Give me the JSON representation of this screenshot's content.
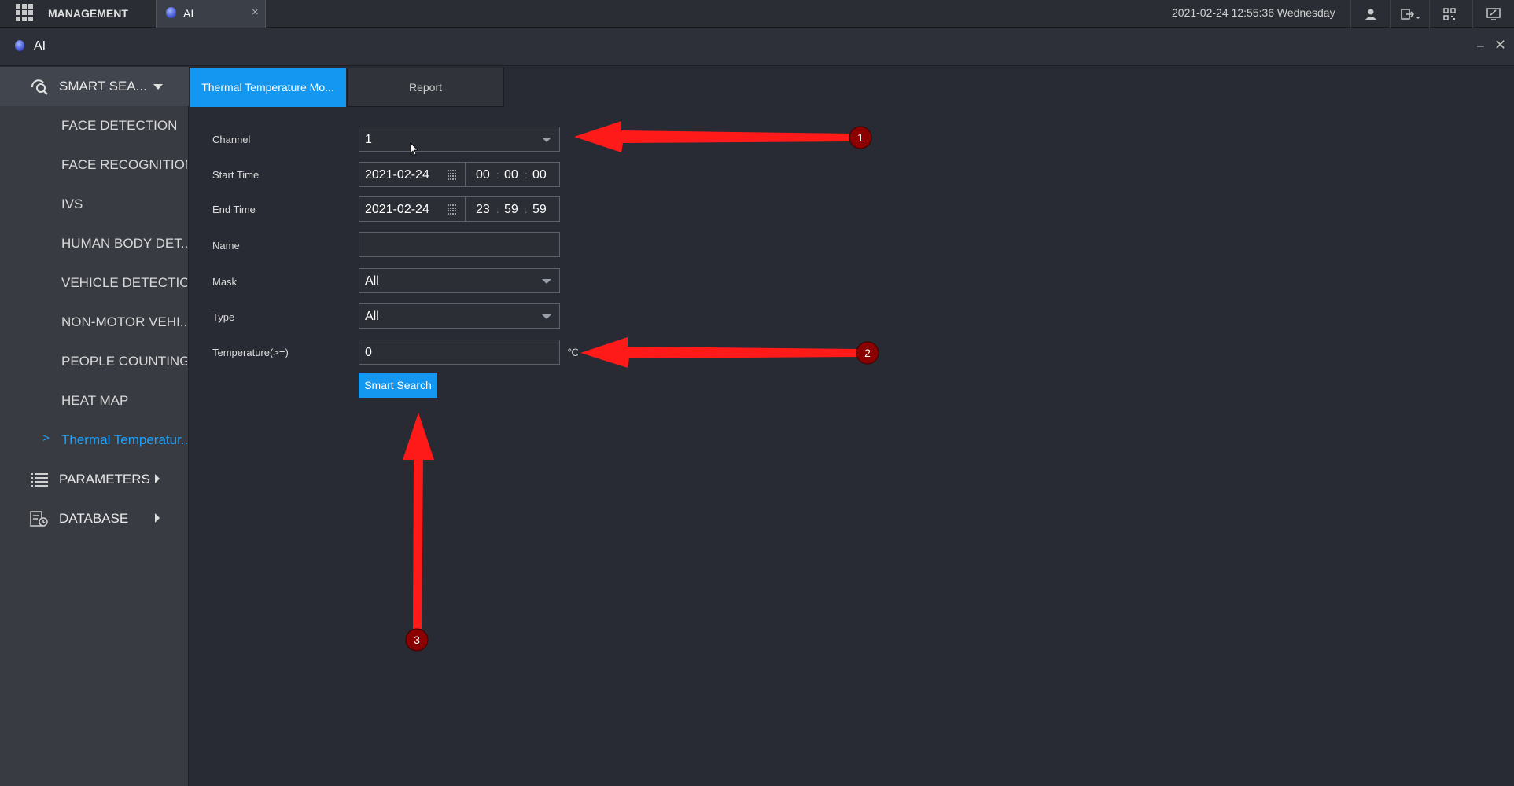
{
  "topbar": {
    "app_label": "MANAGEMENT",
    "tab_label": "AI",
    "tab_close": "×",
    "datetime": "2021-02-24 12:55:36 Wednesday"
  },
  "window": {
    "title": "AI",
    "minimize": "–",
    "close": "✕"
  },
  "sidebar": {
    "smart_search": "SMART SEA...",
    "items": [
      {
        "label": "FACE DETECTION"
      },
      {
        "label": "FACE RECOGNITION"
      },
      {
        "label": "IVS"
      },
      {
        "label": "HUMAN BODY DET..."
      },
      {
        "label": "VEHICLE DETECTION"
      },
      {
        "label": "NON-MOTOR VEHI..."
      },
      {
        "label": "PEOPLE COUNTING"
      },
      {
        "label": "HEAT MAP"
      },
      {
        "label": "Thermal Temperatur..."
      }
    ],
    "selected_chevron": ">",
    "parameters": "PARAMETERS",
    "database": "DATABASE"
  },
  "tabs": {
    "active": "Thermal Temperature Mo...",
    "report": "Report"
  },
  "form": {
    "channel_label": "Channel",
    "channel_value": "1",
    "start_label": "Start Time",
    "start_date": "2021-02-24",
    "start_h": "00",
    "start_m": "00",
    "start_s": "00",
    "end_label": "End Time",
    "end_date": "2021-02-24",
    "end_h": "23",
    "end_m": "59",
    "end_s": "59",
    "time_sep": ":",
    "name_label": "Name",
    "name_value": "",
    "mask_label": "Mask",
    "mask_value": "All",
    "type_label": "Type",
    "type_value": "All",
    "temp_label": "Temperature(>=)",
    "temp_value": "0",
    "temp_unit": "℃",
    "search_button": "Smart Search"
  },
  "annotations": {
    "one": "1",
    "two": "2",
    "three": "3"
  },
  "colors": {
    "accent": "#1497f0",
    "annotation": "#ff1a1a",
    "badge": "#8b0000"
  }
}
